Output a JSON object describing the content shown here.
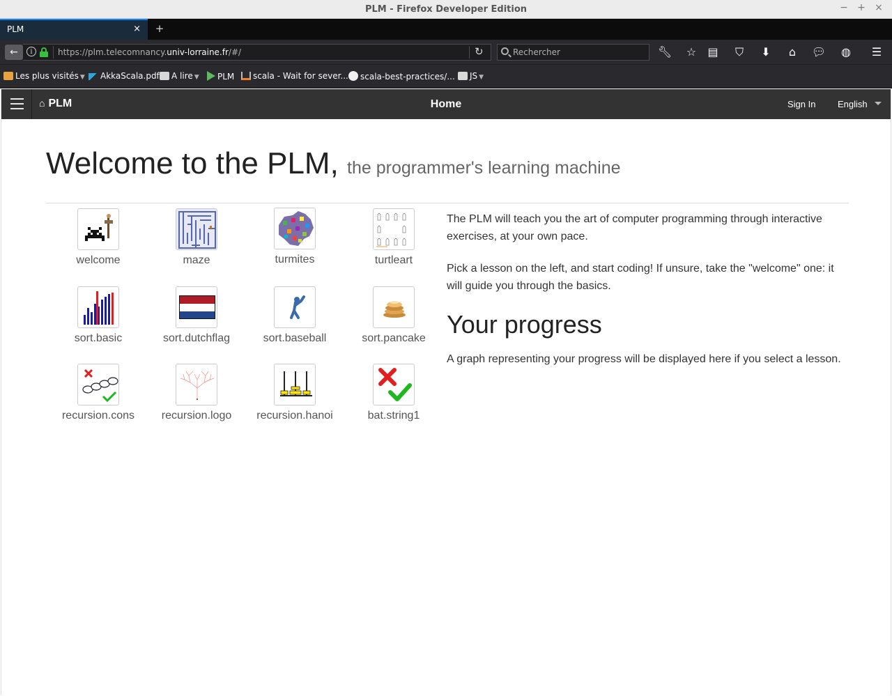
{
  "window": {
    "title": "PLM - Firefox Developer Edition",
    "controls": [
      "−",
      "+",
      "×"
    ]
  },
  "tab": {
    "label": "PLM",
    "close": "×",
    "new_tab": "+"
  },
  "urlbar": {
    "url_prefix": "https://plm.telecomnancy.",
    "url_host": "univ-lorraine.fr",
    "url_suffix": "/#/"
  },
  "searchbar": {
    "placeholder": "Rechercher"
  },
  "bookmarks": [
    {
      "label": "Les plus visités",
      "icon": "folder-icon",
      "has_menu": true
    },
    {
      "label": "AkkaScala.pdf",
      "icon": "akka-icon",
      "has_menu": false
    },
    {
      "label": "A lire",
      "icon": "folder-icon",
      "has_menu": true
    },
    {
      "label": "PLM",
      "icon": "play-icon",
      "has_menu": false
    },
    {
      "label": "scala - Wait for sever...",
      "icon": "stackoverflow-icon",
      "has_menu": false
    },
    {
      "label": "scala-best-practices/...",
      "icon": "github-icon",
      "has_menu": false
    },
    {
      "label": "JS",
      "icon": "folder-icon",
      "has_menu": true
    }
  ],
  "app": {
    "brand": "PLM",
    "nav_title": "Home",
    "sign_in": "Sign In",
    "language": "English"
  },
  "main": {
    "title": "Welcome to the PLM,",
    "subtitle": "the programmer's learning machine",
    "intro_1": "The PLM will teach you the art of computer programming through interactive exercises, at your own pace.",
    "intro_2": "Pick a lesson on the left, and start coding! If unsure, take the \"welcome\" one: it will guide you through the basics.",
    "progress_heading": "Your progress",
    "progress_text": "A graph representing your progress will be displayed here if you select a lesson."
  },
  "lessons": [
    {
      "name": "welcome",
      "icon": "space-invader-buggle-icon"
    },
    {
      "name": "maze",
      "icon": "maze-icon"
    },
    {
      "name": "turmites",
      "icon": "turmites-pattern-icon"
    },
    {
      "name": "turtleart",
      "icon": "turtle-art-icon"
    },
    {
      "name": "sort.basic",
      "icon": "bar-sort-icon"
    },
    {
      "name": "sort.dutchflag",
      "icon": "dutch-flag-icon"
    },
    {
      "name": "sort.baseball",
      "icon": "baseball-player-icon"
    },
    {
      "name": "sort.pancake",
      "icon": "pancake-stack-icon"
    },
    {
      "name": "recursion.cons",
      "icon": "linked-list-icon"
    },
    {
      "name": "recursion.logo",
      "icon": "fractal-tree-icon"
    },
    {
      "name": "recursion.hanoi",
      "icon": "hanoi-towers-icon"
    },
    {
      "name": "bat.string1",
      "icon": "cross-check-icon"
    }
  ],
  "colors": {
    "tab_accent": "#0a84ff",
    "lock_green": "#35c13d",
    "app_nav_bg": "#333333",
    "dutch_red": "#ae1c28",
    "dutch_blue": "#21468b"
  }
}
